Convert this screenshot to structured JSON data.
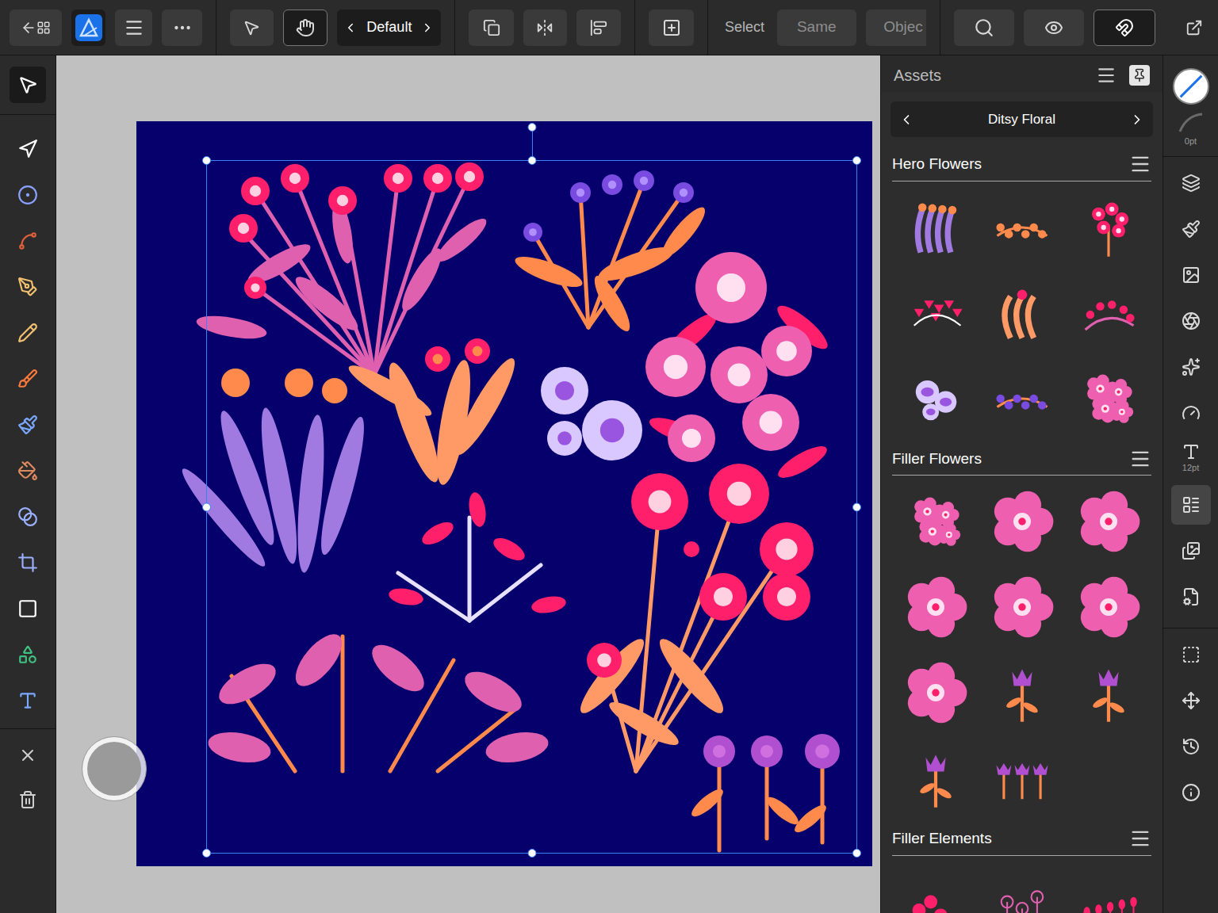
{
  "top_bar": {
    "persona_selected": true,
    "hand_selected": true,
    "snapping_selected": true,
    "style_label": "Default",
    "select_label": "Select",
    "same_label": "Same",
    "object_label": "Objec"
  },
  "left_tools": [
    {
      "kind": "move",
      "selected": true
    },
    {
      "kind": "node",
      "selected": false
    },
    {
      "kind": "contour",
      "selected": false
    },
    {
      "kind": "corner",
      "selected": false
    },
    {
      "kind": "pen",
      "selected": false
    },
    {
      "kind": "pencil",
      "selected": false
    },
    {
      "kind": "vector-brush",
      "selected": false
    },
    {
      "kind": "paint-brush",
      "selected": false
    },
    {
      "kind": "fill",
      "selected": false
    },
    {
      "kind": "transparency",
      "selected": false
    },
    {
      "kind": "crop",
      "selected": false
    },
    {
      "kind": "rectangle",
      "selected": false
    },
    {
      "kind": "shape-builder",
      "selected": false
    },
    {
      "kind": "text",
      "selected": false
    }
  ],
  "left_actions": [
    {
      "kind": "close"
    },
    {
      "kind": "delete"
    }
  ],
  "canvas": {
    "selection_visible": true
  },
  "assets": {
    "title": "Assets",
    "category": "Ditsy Floral",
    "sections": [
      {
        "title": "Hero Flowers",
        "items": [
          {
            "kind": "stems",
            "color": "#a07ae0"
          },
          {
            "kind": "spray",
            "color": "#ff8a4c"
          },
          {
            "kind": "bunch",
            "color": "#ff1f6b"
          },
          {
            "kind": "bush",
            "color": "#ff1f6b"
          },
          {
            "kind": "tulip",
            "color": "#ff9a66"
          },
          {
            "kind": "berries",
            "color": "#e060b0"
          },
          {
            "kind": "blossom",
            "color": "#d9c8ff"
          },
          {
            "kind": "spray",
            "color": "#7a4be0"
          },
          {
            "kind": "cluster",
            "color": "#ee5fb0"
          }
        ]
      },
      {
        "title": "Filler Flowers",
        "items": [
          {
            "kind": "cluster",
            "color": "#ee5fb0"
          },
          {
            "kind": "flower",
            "color": "#ee5fb0"
          },
          {
            "kind": "flower",
            "color": "#ee5fb0"
          },
          {
            "kind": "flower",
            "color": "#ee5fb0"
          },
          {
            "kind": "flower",
            "color": "#ee5fb0"
          },
          {
            "kind": "flower",
            "color": "#ee5fb0"
          },
          {
            "kind": "flower",
            "color": "#ee5fb0"
          },
          {
            "kind": "bud",
            "color": "#b050d0"
          },
          {
            "kind": "bud",
            "color": "#b050d0"
          },
          {
            "kind": "bud",
            "color": "#b050d0"
          },
          {
            "kind": "trio",
            "color": "#b050d0"
          }
        ]
      },
      {
        "title": "Filler Elements",
        "items": [
          {
            "kind": "dots",
            "color": "#ff1f6b"
          },
          {
            "kind": "stalks",
            "color": "#e060b0"
          },
          {
            "kind": "pins",
            "color": "#ff1f6b"
          }
        ]
      }
    ]
  },
  "studio": {
    "stroke_width": "0pt",
    "items": [
      {
        "kind": "layers",
        "selected": false
      },
      {
        "kind": "brushes",
        "selected": false
      },
      {
        "kind": "navigator",
        "selected": false
      },
      {
        "kind": "appearance",
        "selected": false
      },
      {
        "kind": "effects",
        "selected": false
      },
      {
        "kind": "styles",
        "selected": false
      },
      {
        "kind": "text-styles",
        "selected": false,
        "label": "12pt"
      },
      {
        "kind": "assets",
        "selected": true
      },
      {
        "kind": "stock",
        "selected": false
      },
      {
        "kind": "resources",
        "selected": false
      }
    ],
    "bottom_items": [
      {
        "kind": "transform"
      },
      {
        "kind": "snapping"
      },
      {
        "kind": "history"
      },
      {
        "kind": "help"
      }
    ]
  }
}
